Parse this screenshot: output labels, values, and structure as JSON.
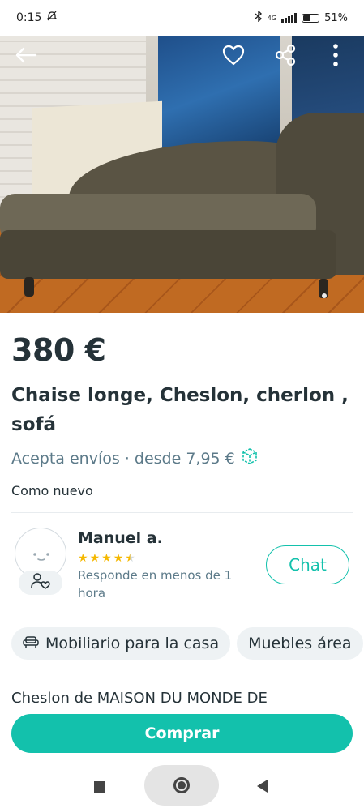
{
  "status_bar": {
    "time": "0:15",
    "network": "4G",
    "battery": "51%",
    "battery_level": 0.51
  },
  "hero": {
    "icons": [
      "back-arrow-icon",
      "heart-icon",
      "share-icon",
      "more-vertical-icon"
    ],
    "image_count_indicator": "1"
  },
  "product": {
    "price": "380 €",
    "title": "Chaise longe, Cheslon, cherlon , sofá",
    "shipping": "Acepta envíos · desde 7,95 €",
    "condition": "Como nuevo"
  },
  "seller": {
    "name": "Manuel a.",
    "rating": 4.5,
    "rating_max": 5,
    "response": "Responde en menos de 1 hora",
    "chat_label": "Chat"
  },
  "categories": [
    {
      "label": "Mobiliario para la casa",
      "icon": "sofa-icon"
    },
    {
      "label": "Muebles área"
    }
  ],
  "description": {
    "text": "Cheslon de MAISON DU MONDE DE"
  },
  "actions": {
    "buy_label": "Comprar"
  },
  "colors": {
    "accent": "#13c1ac",
    "text": "#253238",
    "muted": "#5c7a89",
    "star": "#f5b800"
  }
}
